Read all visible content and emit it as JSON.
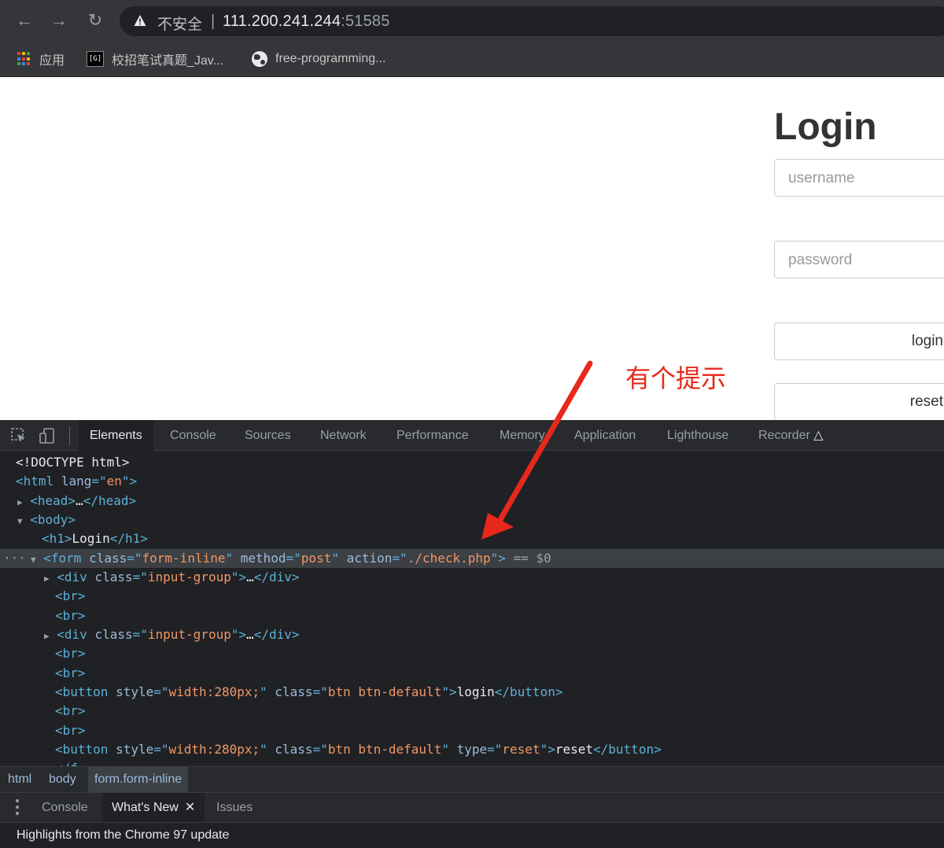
{
  "browser": {
    "nav": {
      "back_icon": "←",
      "forward_icon": "→",
      "reload_icon": "↻"
    },
    "omnibox": {
      "security_label": "不安全",
      "separator": "|",
      "host": "111.200.241.244",
      "port": ":51585"
    },
    "bookmarks": [
      {
        "label": "应用",
        "icon": "apps-grid-icon"
      },
      {
        "label": "校招笔试真题_Jav...",
        "icon": "site-favicon-icon"
      },
      {
        "label": "free-programming...",
        "icon": "globe-icon"
      }
    ]
  },
  "page": {
    "title": "Login",
    "username_placeholder": "username",
    "password_placeholder": "password",
    "login_button": "login",
    "reset_button": "reset"
  },
  "annotation": {
    "hint": "有个提示",
    "color": "#e8281b"
  },
  "devtools": {
    "tabs": [
      "Elements",
      "Console",
      "Sources",
      "Network",
      "Performance",
      "Memory",
      "Application",
      "Lighthouse",
      "Recorder"
    ],
    "active_tab": "Elements",
    "selected_marker": "== $0",
    "breadcrumbs": [
      "html",
      "body",
      "form.form-inline"
    ],
    "drawer": {
      "tabs": [
        "Console",
        "What's New",
        "Issues"
      ],
      "active_tab": "What's New",
      "body_text": "Highlights from the Chrome 97 update"
    }
  },
  "colors": {
    "chrome_bg": "#35363a",
    "devtools_bg": "#202124",
    "tag": "#5db0d7",
    "attr_value": "#f29766",
    "selected_row": "#3c3f44"
  }
}
